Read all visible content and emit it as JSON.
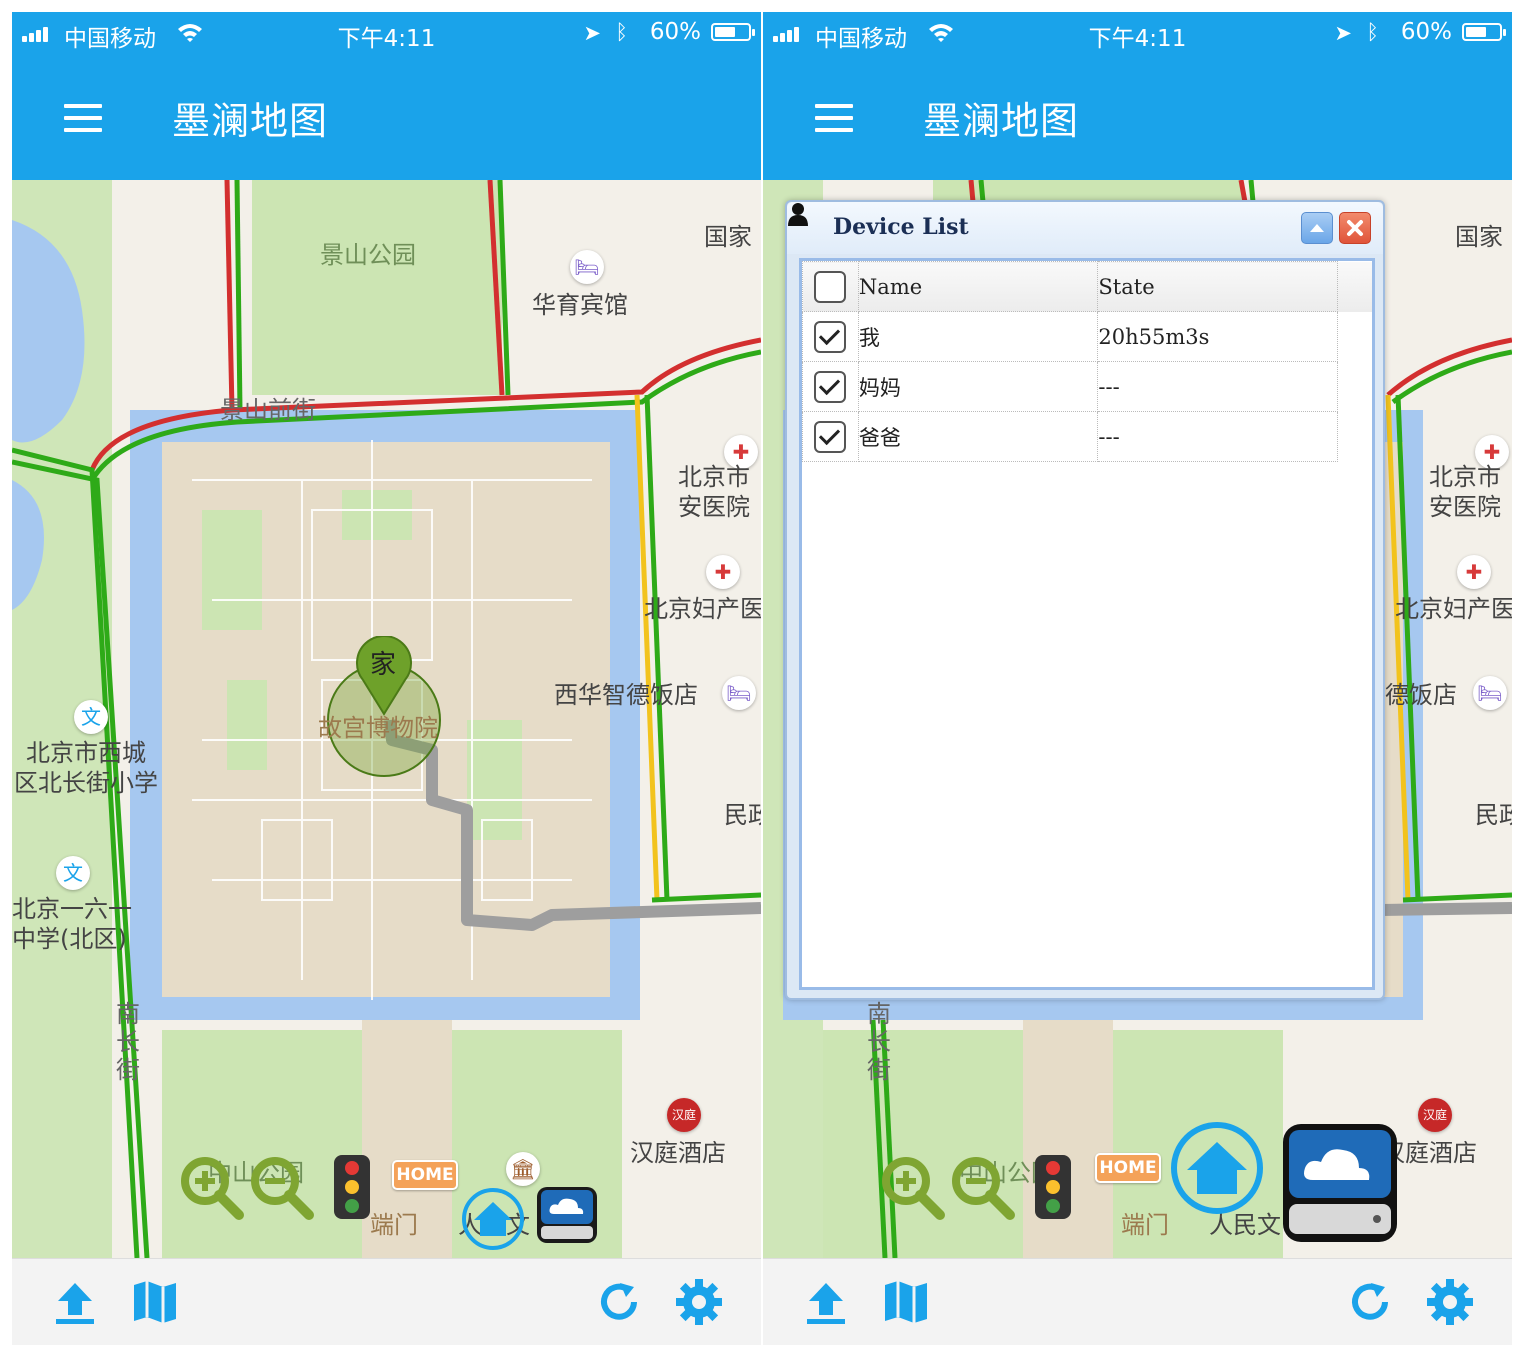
{
  "left_screen": {
    "status": {
      "carrier": "中国移动",
      "time": "下午4:11",
      "battery": "60%"
    },
    "app_title": "墨澜地图",
    "map_labels": {
      "jingshan_park": "景山公园",
      "huayu_hotel": "华育宾馆",
      "guojia": "国家",
      "jingshan_qianjie": "景山前街",
      "beijingshi_anyiyuan": "北京市\n安医院",
      "beijing_fuchan": "北京妇产医",
      "xihua_hotel": "西华智德饭店",
      "gugong": "故宫博物院",
      "xicheng_school": "北京市西城\n区北长街小学",
      "yiliuyi_school": "北京一六一\n中学(北区)",
      "minzheng": "民政",
      "nanchang_jie": "南\n长\n街",
      "hanting": "汉庭酒店",
      "zhongshan_park": "中山公园",
      "duanmen": "端门",
      "renmin": "人民文"
    },
    "marker_label": "家"
  },
  "right_screen": {
    "status": {
      "carrier": "中国移动",
      "time": "下午4:11",
      "battery": "60%"
    },
    "app_title": "墨澜地图",
    "map_labels": {
      "guojia": "国家",
      "beijingshi_anyiyuan": "北京市\n安医院",
      "beijing_fuchan": "北京妇产医",
      "defandian": "德饭店",
      "minzheng": "民政",
      "nanchang_jie": "南\n长\n街",
      "hanting": "汉庭酒店",
      "zhongshan_park": "中山公园",
      "duanmen": "端门",
      "renmin": "人民文"
    },
    "device_list": {
      "title": "Device List",
      "columns": [
        "Name",
        "State"
      ],
      "rows": [
        {
          "name": "我",
          "state": "20h55m3s",
          "checked": true
        },
        {
          "name": "妈妈",
          "state": "---",
          "checked": true
        },
        {
          "name": "爸爸",
          "state": "---",
          "checked": true
        }
      ]
    }
  },
  "tools": {
    "home_label": "HOME"
  },
  "colors": {
    "primary": "#1aa3ea",
    "park": "#cce5b3",
    "palace": "#e6dcc8",
    "moat": "#a6c8f0",
    "marker": "#6ea12a"
  }
}
